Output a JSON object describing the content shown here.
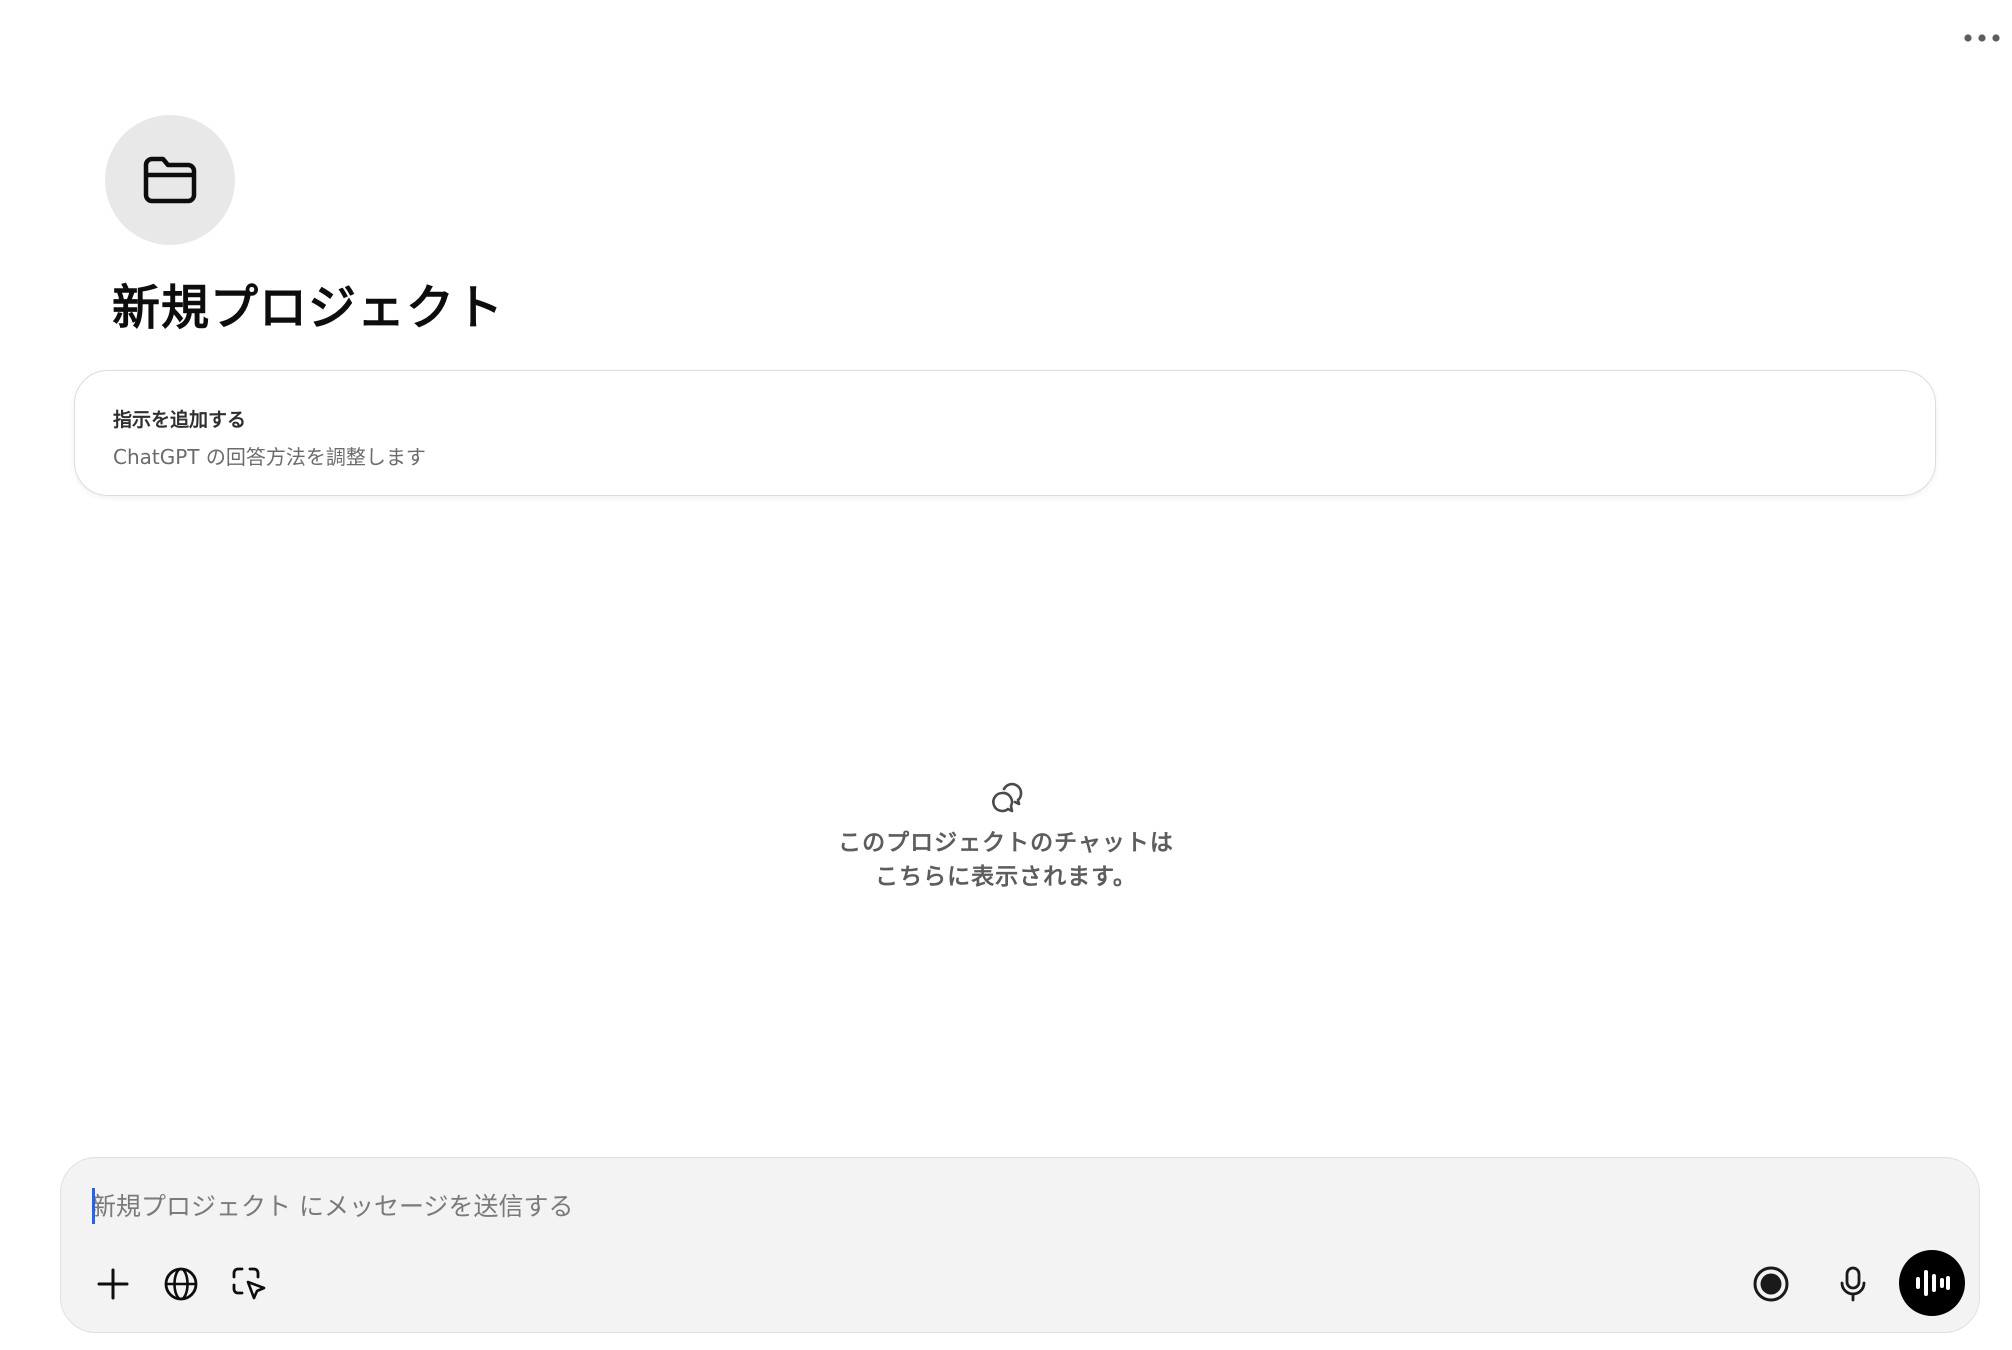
{
  "header": {
    "more_icon": "more-horizontal-icon"
  },
  "project": {
    "icon": "folder-icon",
    "title": "新規プロジェクト"
  },
  "instructions": {
    "title": "指示を追加する",
    "subtitle": "ChatGPT の回答方法を調整します"
  },
  "empty_state": {
    "icon": "chat-bubbles-icon",
    "line1": "このプロジェクトのチャットは",
    "line2": "こちらに表示されます。"
  },
  "composer": {
    "placeholder": "新規プロジェクト にメッセージを送信する",
    "value": "",
    "tools_left": [
      "plus-icon",
      "globe-icon",
      "screen-select-icon"
    ],
    "tools_right": [
      "record-icon",
      "microphone-icon",
      "voice-mode-icon"
    ]
  },
  "colors": {
    "background": "#ffffff",
    "composer_bg": "#f3f3f3",
    "icon_circle": "#e8e8e8",
    "caret": "#2563eb",
    "voice_button": "#000000"
  }
}
